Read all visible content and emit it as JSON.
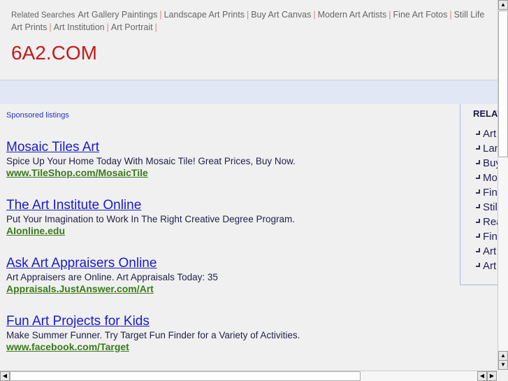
{
  "related": {
    "label": "Related Searches",
    "links": [
      "Art Gallery Paintings",
      "Landscape Art Prints",
      "Buy Art Canvas",
      "Modern Art Artists",
      "Fine Art Fotos",
      "Still Life Art Prints",
      "Art Institution",
      "Art Portrait"
    ]
  },
  "logo": "6A2.COM",
  "sponsored": "Sponsored listings",
  "ads": [
    {
      "title": "Mosaic Tiles Art",
      "desc": "Spice Up Your Home Today With Mosaic Tile! Great Prices, Buy Now.",
      "url": "www.TileShop.com/MosaicTile"
    },
    {
      "title": "The Art Institute Online",
      "desc": "Put Your Imagination to Work In The Right Creative Degree Program.",
      "url": "AIonline.edu"
    },
    {
      "title": "Ask Art Appraisers Online",
      "desc": "Art Appraisers are Online. Art Appraisals Today: 35",
      "url": "Appraisals.JustAnswer.com/Art"
    },
    {
      "title": "Fun Art Projects for Kids",
      "desc": "Make Summer Funner. Try Target Fun Finder for a Variety of Activities.",
      "url": "www.facebook.com/Target"
    }
  ],
  "sidebar": {
    "title": "RELAT",
    "items": [
      "Art",
      "Lan",
      "Buy",
      "Moc",
      "Fin",
      "Stil",
      "Rea",
      "Fin",
      "Art",
      "Art"
    ]
  }
}
